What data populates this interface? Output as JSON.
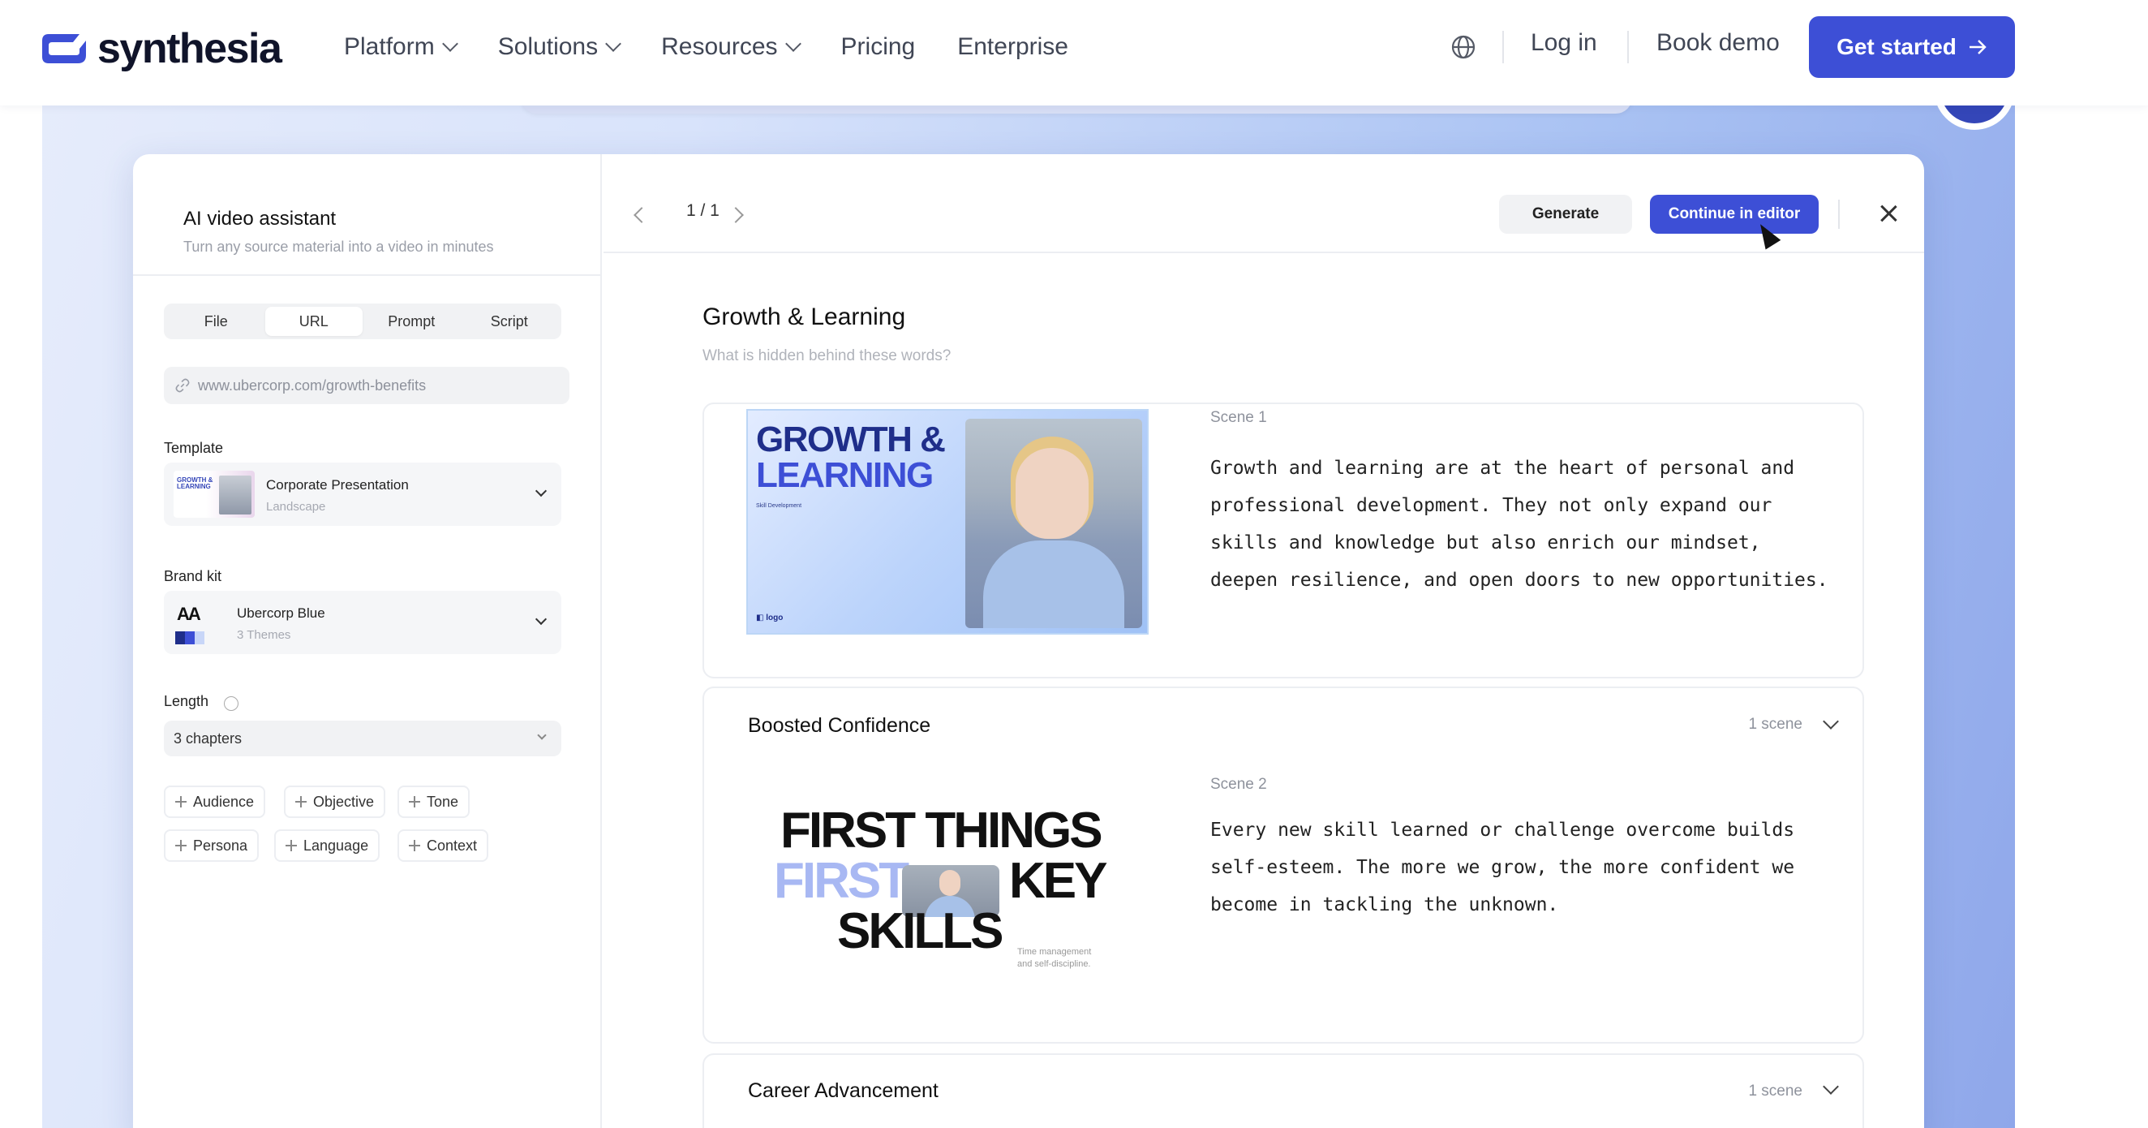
{
  "nav": {
    "logo_text": "synthesia",
    "links": [
      {
        "label": "Platform",
        "dropdown": true
      },
      {
        "label": "Solutions",
        "dropdown": true
      },
      {
        "label": "Resources",
        "dropdown": true
      },
      {
        "label": "Pricing",
        "dropdown": false
      },
      {
        "label": "Enterprise",
        "dropdown": false
      }
    ],
    "globe_icon": "globe-icon",
    "login": "Log in",
    "book_demo": "Book demo",
    "get_started": "Get started",
    "accent": "#3d4fd6"
  },
  "sidebar": {
    "title": "AI video assistant",
    "subtitle": "Turn any source material into a video in minutes",
    "source_tabs": [
      {
        "label": "File",
        "active": false
      },
      {
        "label": "URL",
        "active": true
      },
      {
        "label": "Prompt",
        "active": false
      },
      {
        "label": "Script",
        "active": false
      }
    ],
    "url_value": "www.ubercorp.com/growth-benefits",
    "template": {
      "label": "Template",
      "name": "Corporate Presentation",
      "sub": "Landscape",
      "thumb_text": "GROWTH & LEARNING"
    },
    "brand_kit": {
      "label": "Brand kit",
      "name": "Ubercorp Blue",
      "sub": "3 Themes",
      "thumb_text": "AA",
      "swatches": [
        "#1f2e8a",
        "#3d4fd6",
        "#c8d6f8"
      ]
    },
    "length": {
      "label": "Length",
      "value": "3 chapters"
    },
    "chips": [
      "Audience",
      "Objective",
      "Tone",
      "Persona",
      "Language",
      "Context"
    ]
  },
  "main": {
    "pager": "1 / 1",
    "generate": "Generate",
    "continue": "Continue in editor",
    "section_title": "Growth & Learning",
    "section_sub": "What is hidden behind these words?",
    "scene1": {
      "label": "Scene 1",
      "thumb_title_1": "GROWTH &",
      "thumb_title_2": "LEARNING",
      "thumb_sub": "Skill Development",
      "thumb_logo": "logo",
      "text_lines": [
        "Growth and learning are at the heart of personal and",
        "professional development. They not only expand our",
        "skills and knowledge but also enrich our mindset,",
        "deepen resilience, and open doors to new opportunities."
      ]
    },
    "chapter2": {
      "title": "Boosted Confidence",
      "count": "1 scene",
      "scene_label": "Scene 2",
      "thumb_line1": "FIRST THINGS",
      "thumb_first": "FIRST",
      "thumb_key": "KEY",
      "thumb_line3": "SKILLS",
      "thumb_note_1": "Time management",
      "thumb_note_2": "and self-discipline.",
      "text_lines": [
        "Every new skill learned or challenge overcome builds",
        "self-esteem. The more we grow, the more confident we",
        "become in tackling the unknown."
      ]
    },
    "chapter3": {
      "title": "Career Advancement",
      "count": "1 scene"
    }
  }
}
